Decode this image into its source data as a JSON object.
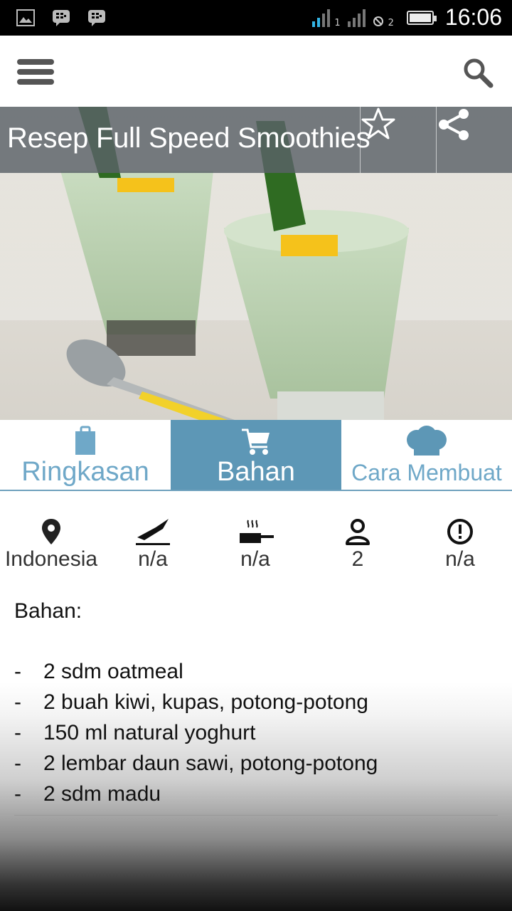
{
  "status_bar": {
    "time": "16:06",
    "sim2_label": "1",
    "sim2b_label": "2",
    "icons": [
      "image-icon",
      "bbm-icon",
      "bbm-icon",
      "signal-icon",
      "no-sim-icon",
      "battery-icon"
    ]
  },
  "app_bar": {
    "menu_icon": "hamburger-menu-icon",
    "search_icon": "search-icon"
  },
  "recipe": {
    "title": "Resep Full Speed Smoothies",
    "star_icon": "star-icon",
    "share_icon": "share-icon"
  },
  "tabs": [
    {
      "label": "Ringkasan",
      "icon": "clipboard-icon",
      "active": false
    },
    {
      "label": "Bahan",
      "icon": "cart-icon",
      "active": true
    },
    {
      "label": "Cara Membuat",
      "icon": "chef-hat-icon",
      "active": false
    }
  ],
  "info": [
    {
      "icon": "location-pin-icon",
      "value": "Indonesia"
    },
    {
      "icon": "knife-icon",
      "value": "n/a"
    },
    {
      "icon": "cooking-pan-icon",
      "value": "n/a"
    },
    {
      "icon": "person-icon",
      "value": "2"
    },
    {
      "icon": "alert-icon",
      "value": "n/a"
    }
  ],
  "ingredients": {
    "heading": "Bahan:",
    "bullet": "-",
    "items": [
      "2 sdm oatmeal",
      "2 buah kiwi, kupas, potong-potong",
      "150 ml natural yoghurt",
      "2 lembar daun sawi, potong-potong",
      "2 sdm madu"
    ]
  },
  "colors": {
    "accent": "#5d97b6",
    "tab_text": "#6fa8c8",
    "title_overlay": "#5a6268"
  }
}
